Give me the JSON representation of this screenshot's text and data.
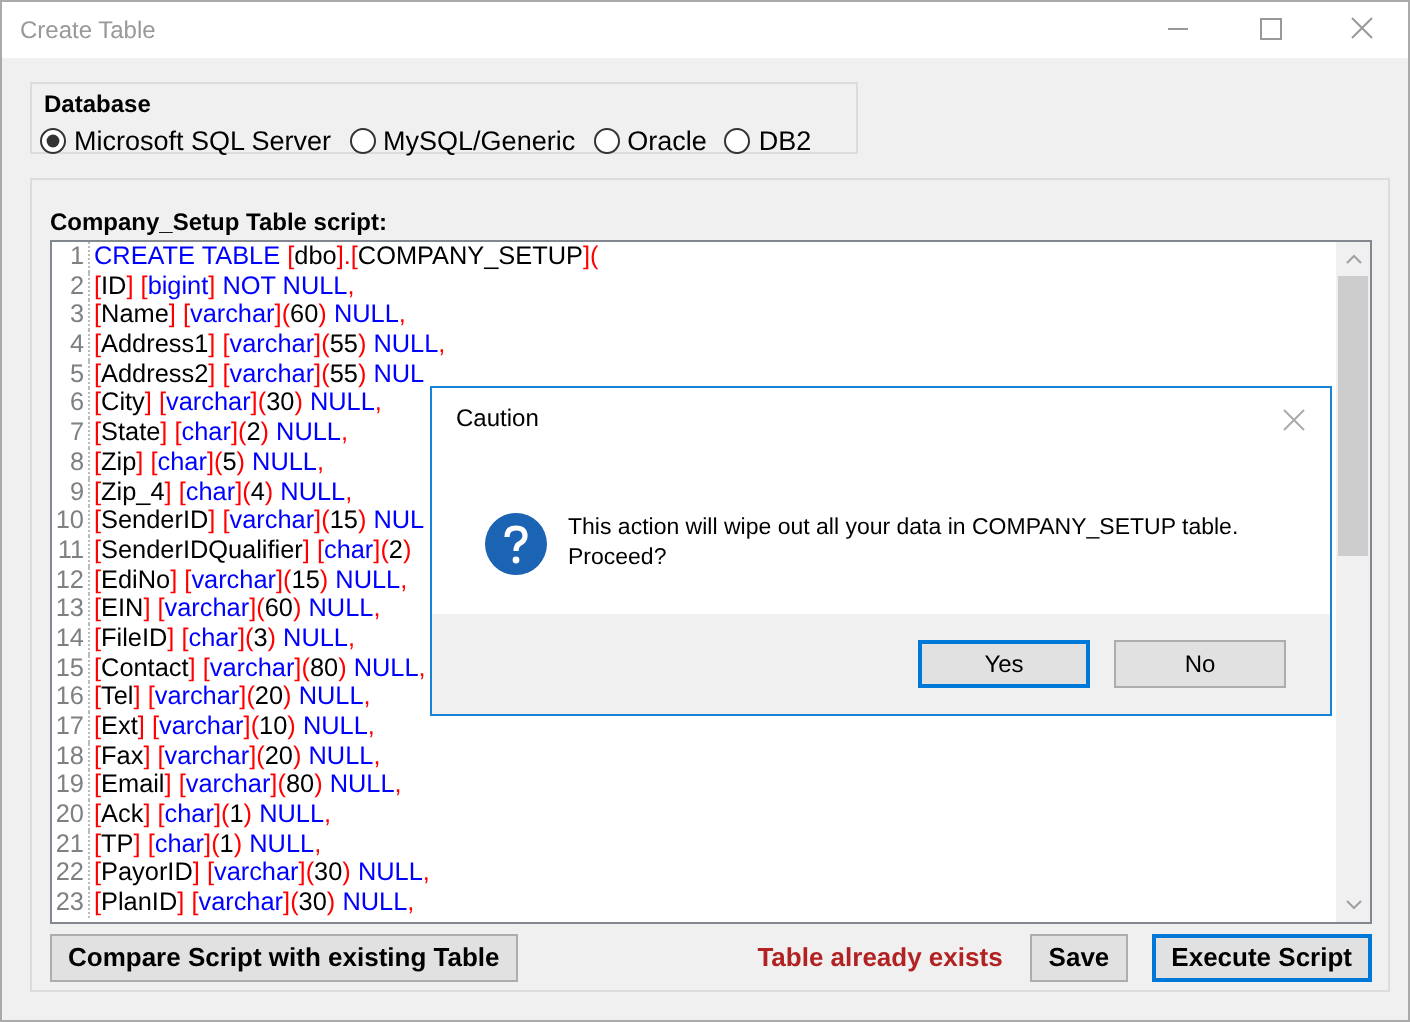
{
  "window": {
    "title": "Create Table"
  },
  "database": {
    "label": "Database",
    "options": [
      {
        "label": "Microsoft SQL Server",
        "selected": true
      },
      {
        "label": "MySQL/Generic",
        "selected": false
      },
      {
        "label": "Oracle",
        "selected": false
      },
      {
        "label": "DB2",
        "selected": false
      }
    ]
  },
  "script": {
    "label": "Company_Setup Table script:",
    "lines": [
      {
        "number": "1",
        "tokens": [
          {
            "kind": "keyword",
            "text": "CREATE TABLE"
          },
          {
            "kind": "name",
            "text": " [dbo]"
          },
          {
            "kind": "punct",
            "text": "."
          },
          {
            "kind": "name",
            "text": "[COMPANY_SETUP]"
          },
          {
            "kind": "punct",
            "text": "("
          }
        ]
      },
      {
        "number": "2",
        "tokens": [
          {
            "kind": "name",
            "text": "[ID]"
          },
          {
            "kind": "type",
            "text": " [bigint]"
          },
          {
            "kind": "keyword",
            "text": " NOT NULL"
          },
          {
            "kind": "punct",
            "text": ","
          }
        ]
      },
      {
        "number": "3",
        "tokens": [
          {
            "kind": "name",
            "text": "[Name]"
          },
          {
            "kind": "type",
            "text": " [varchar]"
          },
          {
            "kind": "punct",
            "text": "("
          },
          {
            "kind": "plain",
            "text": "60"
          },
          {
            "kind": "punct",
            "text": ")"
          },
          {
            "kind": "keyword",
            "text": " NULL"
          },
          {
            "kind": "punct",
            "text": ","
          }
        ]
      },
      {
        "number": "4",
        "tokens": [
          {
            "kind": "name",
            "text": "[Address1]"
          },
          {
            "kind": "type",
            "text": " [varchar]"
          },
          {
            "kind": "punct",
            "text": "("
          },
          {
            "kind": "plain",
            "text": "55"
          },
          {
            "kind": "punct",
            "text": ")"
          },
          {
            "kind": "keyword",
            "text": " NULL"
          },
          {
            "kind": "punct",
            "text": ","
          }
        ]
      },
      {
        "number": "5",
        "tokens": [
          {
            "kind": "name",
            "text": "[Address2]"
          },
          {
            "kind": "type",
            "text": " [varchar]"
          },
          {
            "kind": "punct",
            "text": "("
          },
          {
            "kind": "plain",
            "text": "55"
          },
          {
            "kind": "punct",
            "text": ")"
          },
          {
            "kind": "keyword",
            "text": " NUL"
          }
        ]
      },
      {
        "number": "6",
        "tokens": [
          {
            "kind": "name",
            "text": "[City]"
          },
          {
            "kind": "type",
            "text": " [varchar]"
          },
          {
            "kind": "punct",
            "text": "("
          },
          {
            "kind": "plain",
            "text": "30"
          },
          {
            "kind": "punct",
            "text": ")"
          },
          {
            "kind": "keyword",
            "text": " NULL"
          },
          {
            "kind": "punct",
            "text": ","
          }
        ]
      },
      {
        "number": "7",
        "tokens": [
          {
            "kind": "name",
            "text": "[State]"
          },
          {
            "kind": "type",
            "text": " [char]"
          },
          {
            "kind": "punct",
            "text": "("
          },
          {
            "kind": "plain",
            "text": "2"
          },
          {
            "kind": "punct",
            "text": ")"
          },
          {
            "kind": "keyword",
            "text": " NULL"
          },
          {
            "kind": "punct",
            "text": ","
          }
        ]
      },
      {
        "number": "8",
        "tokens": [
          {
            "kind": "name",
            "text": "[Zip]"
          },
          {
            "kind": "type",
            "text": " [char]"
          },
          {
            "kind": "punct",
            "text": "("
          },
          {
            "kind": "plain",
            "text": "5"
          },
          {
            "kind": "punct",
            "text": ")"
          },
          {
            "kind": "keyword",
            "text": " NULL"
          },
          {
            "kind": "punct",
            "text": ","
          }
        ]
      },
      {
        "number": "9",
        "tokens": [
          {
            "kind": "name",
            "text": "[Zip_4]"
          },
          {
            "kind": "type",
            "text": " [char]"
          },
          {
            "kind": "punct",
            "text": "("
          },
          {
            "kind": "plain",
            "text": "4"
          },
          {
            "kind": "punct",
            "text": ")"
          },
          {
            "kind": "keyword",
            "text": " NULL"
          },
          {
            "kind": "punct",
            "text": ","
          }
        ]
      },
      {
        "number": "10",
        "tokens": [
          {
            "kind": "name",
            "text": "[SenderID]"
          },
          {
            "kind": "type",
            "text": " [varchar]"
          },
          {
            "kind": "punct",
            "text": "("
          },
          {
            "kind": "plain",
            "text": "15"
          },
          {
            "kind": "punct",
            "text": ")"
          },
          {
            "kind": "keyword",
            "text": " NUL"
          }
        ]
      },
      {
        "number": "11",
        "tokens": [
          {
            "kind": "name",
            "text": "[SenderIDQualifier]"
          },
          {
            "kind": "type",
            "text": " [char]"
          },
          {
            "kind": "punct",
            "text": "("
          },
          {
            "kind": "plain",
            "text": "2"
          },
          {
            "kind": "punct",
            "text": ")"
          }
        ]
      },
      {
        "number": "12",
        "tokens": [
          {
            "kind": "name",
            "text": "[EdiNo]"
          },
          {
            "kind": "type",
            "text": " [varchar]"
          },
          {
            "kind": "punct",
            "text": "("
          },
          {
            "kind": "plain",
            "text": "15"
          },
          {
            "kind": "punct",
            "text": ")"
          },
          {
            "kind": "keyword",
            "text": " NULL"
          },
          {
            "kind": "punct",
            "text": ","
          }
        ]
      },
      {
        "number": "13",
        "tokens": [
          {
            "kind": "name",
            "text": "[EIN]"
          },
          {
            "kind": "type",
            "text": " [varchar]"
          },
          {
            "kind": "punct",
            "text": "("
          },
          {
            "kind": "plain",
            "text": "60"
          },
          {
            "kind": "punct",
            "text": ")"
          },
          {
            "kind": "keyword",
            "text": " NULL"
          },
          {
            "kind": "punct",
            "text": ","
          }
        ]
      },
      {
        "number": "14",
        "tokens": [
          {
            "kind": "name",
            "text": "[FileID]"
          },
          {
            "kind": "type",
            "text": " [char]"
          },
          {
            "kind": "punct",
            "text": "("
          },
          {
            "kind": "plain",
            "text": "3"
          },
          {
            "kind": "punct",
            "text": ")"
          },
          {
            "kind": "keyword",
            "text": " NULL"
          },
          {
            "kind": "punct",
            "text": ","
          }
        ]
      },
      {
        "number": "15",
        "tokens": [
          {
            "kind": "name",
            "text": "[Contact]"
          },
          {
            "kind": "type",
            "text": " [varchar]"
          },
          {
            "kind": "punct",
            "text": "("
          },
          {
            "kind": "plain",
            "text": "80"
          },
          {
            "kind": "punct",
            "text": ")"
          },
          {
            "kind": "keyword",
            "text": " NULL"
          },
          {
            "kind": "punct",
            "text": ","
          }
        ]
      },
      {
        "number": "16",
        "tokens": [
          {
            "kind": "name",
            "text": "[Tel]"
          },
          {
            "kind": "type",
            "text": " [varchar]"
          },
          {
            "kind": "punct",
            "text": "("
          },
          {
            "kind": "plain",
            "text": "20"
          },
          {
            "kind": "punct",
            "text": ")"
          },
          {
            "kind": "keyword",
            "text": " NULL"
          },
          {
            "kind": "punct",
            "text": ","
          }
        ]
      },
      {
        "number": "17",
        "tokens": [
          {
            "kind": "name",
            "text": "[Ext]"
          },
          {
            "kind": "type",
            "text": " [varchar]"
          },
          {
            "kind": "punct",
            "text": "("
          },
          {
            "kind": "plain",
            "text": "10"
          },
          {
            "kind": "punct",
            "text": ")"
          },
          {
            "kind": "keyword",
            "text": " NULL"
          },
          {
            "kind": "punct",
            "text": ","
          }
        ]
      },
      {
        "number": "18",
        "tokens": [
          {
            "kind": "name",
            "text": "[Fax]"
          },
          {
            "kind": "type",
            "text": " [varchar]"
          },
          {
            "kind": "punct",
            "text": "("
          },
          {
            "kind": "plain",
            "text": "20"
          },
          {
            "kind": "punct",
            "text": ")"
          },
          {
            "kind": "keyword",
            "text": " NULL"
          },
          {
            "kind": "punct",
            "text": ","
          }
        ]
      },
      {
        "number": "19",
        "tokens": [
          {
            "kind": "name",
            "text": "[Email]"
          },
          {
            "kind": "type",
            "text": " [varchar]"
          },
          {
            "kind": "punct",
            "text": "("
          },
          {
            "kind": "plain",
            "text": "80"
          },
          {
            "kind": "punct",
            "text": ")"
          },
          {
            "kind": "keyword",
            "text": " NULL"
          },
          {
            "kind": "punct",
            "text": ","
          }
        ]
      },
      {
        "number": "20",
        "tokens": [
          {
            "kind": "name",
            "text": "[Ack]"
          },
          {
            "kind": "type",
            "text": " [char]"
          },
          {
            "kind": "punct",
            "text": "("
          },
          {
            "kind": "plain",
            "text": "1"
          },
          {
            "kind": "punct",
            "text": ")"
          },
          {
            "kind": "keyword",
            "text": " NULL"
          },
          {
            "kind": "punct",
            "text": ","
          }
        ]
      },
      {
        "number": "21",
        "tokens": [
          {
            "kind": "name",
            "text": "[TP]"
          },
          {
            "kind": "type",
            "text": " [char]"
          },
          {
            "kind": "punct",
            "text": "("
          },
          {
            "kind": "plain",
            "text": "1"
          },
          {
            "kind": "punct",
            "text": ")"
          },
          {
            "kind": "keyword",
            "text": " NULL"
          },
          {
            "kind": "punct",
            "text": ","
          }
        ]
      },
      {
        "number": "22",
        "tokens": [
          {
            "kind": "name",
            "text": "[PayorID]"
          },
          {
            "kind": "type",
            "text": " [varchar]"
          },
          {
            "kind": "punct",
            "text": "("
          },
          {
            "kind": "plain",
            "text": "30"
          },
          {
            "kind": "punct",
            "text": ")"
          },
          {
            "kind": "keyword",
            "text": " NULL"
          },
          {
            "kind": "punct",
            "text": ","
          }
        ]
      },
      {
        "number": "23",
        "tokens": [
          {
            "kind": "name",
            "text": "[PlanID]"
          },
          {
            "kind": "type",
            "text": " [varchar]"
          },
          {
            "kind": "punct",
            "text": "("
          },
          {
            "kind": "plain",
            "text": "30"
          },
          {
            "kind": "punct",
            "text": ")"
          },
          {
            "kind": "keyword",
            "text": " NULL"
          },
          {
            "kind": "punct",
            "text": ","
          }
        ]
      }
    ]
  },
  "compare_button": {
    "label": "Compare Script with existing Table"
  },
  "status": "Table already exists",
  "buttons": [
    {
      "label": "Save",
      "default": false
    },
    {
      "label": "Execute Script",
      "default": true
    }
  ],
  "dialog": {
    "title": "Caution",
    "message": "This action will wipe out all your data in COMPANY_SETUP table.\nProceed?",
    "buttons": [
      {
        "label": "Yes",
        "default": true
      },
      {
        "label": "No",
        "default": false
      }
    ]
  }
}
